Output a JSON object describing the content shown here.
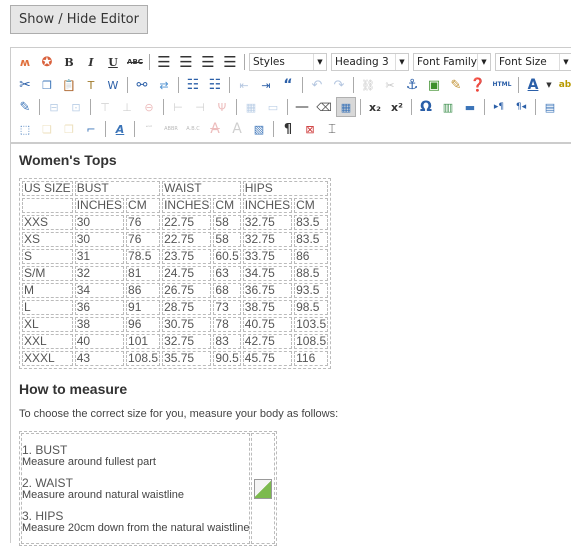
{
  "toggle_button": {
    "label": "Show / Hide Editor"
  },
  "toolbar": {
    "row1": {
      "buttons": [
        {
          "name": "media-icon",
          "glyph": "ʍ",
          "color": "#e0703c"
        },
        {
          "name": "spellcheck-icon",
          "glyph": "✪",
          "color": "#d9603b"
        },
        {
          "name": "bold-icon",
          "glyph": "B"
        },
        {
          "name": "italic-icon",
          "glyph": "I"
        },
        {
          "name": "underline-icon",
          "glyph": "U"
        },
        {
          "name": "strikethrough-icon",
          "glyph": "ABC"
        }
      ],
      "align_buttons": [
        {
          "name": "align-left-icon",
          "glyph": "≡"
        },
        {
          "name": "align-center-icon",
          "glyph": "≡"
        },
        {
          "name": "align-right-icon",
          "glyph": "≡"
        },
        {
          "name": "align-justify-icon",
          "glyph": "≣"
        }
      ],
      "dropdowns": {
        "styles": "Styles",
        "format": "Heading 3",
        "font_family": "Font Family",
        "font_size": "Font Size"
      }
    },
    "row2": {
      "html_label": "HTML"
    }
  },
  "content": {
    "heading1": "Women's Tops",
    "size_table": {
      "header_row1": [
        "US SIZE",
        "BUST",
        "",
        "WAIST",
        "",
        "HIPS",
        ""
      ],
      "header_row2": [
        "",
        "INCHES",
        "CM",
        "INCHES",
        "CM",
        "INCHES",
        "CM"
      ],
      "rows": [
        [
          "XXS",
          "30",
          "76",
          "22.75",
          "58",
          "32.75",
          "83.5"
        ],
        [
          "XS",
          "30",
          "76",
          "22.75",
          "58",
          "32.75",
          "83.5"
        ],
        [
          "S",
          "31",
          "78.5",
          "23.75",
          "60.5",
          "33.75",
          "86"
        ],
        [
          "S/M",
          "32",
          "81",
          "24.75",
          "63",
          "34.75",
          "88.5"
        ],
        [
          "M",
          "34",
          "86",
          "26.75",
          "68",
          "36.75",
          "93.5"
        ],
        [
          "L",
          "36",
          "91",
          "28.75",
          "73",
          "38.75",
          "98.5"
        ],
        [
          "XL",
          "38",
          "96",
          "30.75",
          "78",
          "40.75",
          "103.5"
        ],
        [
          "XXL",
          "40",
          "101",
          "32.75",
          "83",
          "42.75",
          "108.5"
        ],
        [
          "XXXL",
          "43",
          "108.5",
          "35.75",
          "90.5",
          "45.75",
          "116"
        ]
      ]
    },
    "heading2": "How to measure",
    "intro": "To choose the correct size for you, measure your body as follows:",
    "measure_steps": [
      {
        "title": "1. BUST",
        "desc": "Measure around fullest part"
      },
      {
        "title": "2. WAIST",
        "desc": "Measure around natural waistline"
      },
      {
        "title": "3. HIPS",
        "desc": "Measure 20cm down from the natural waistline"
      }
    ]
  }
}
